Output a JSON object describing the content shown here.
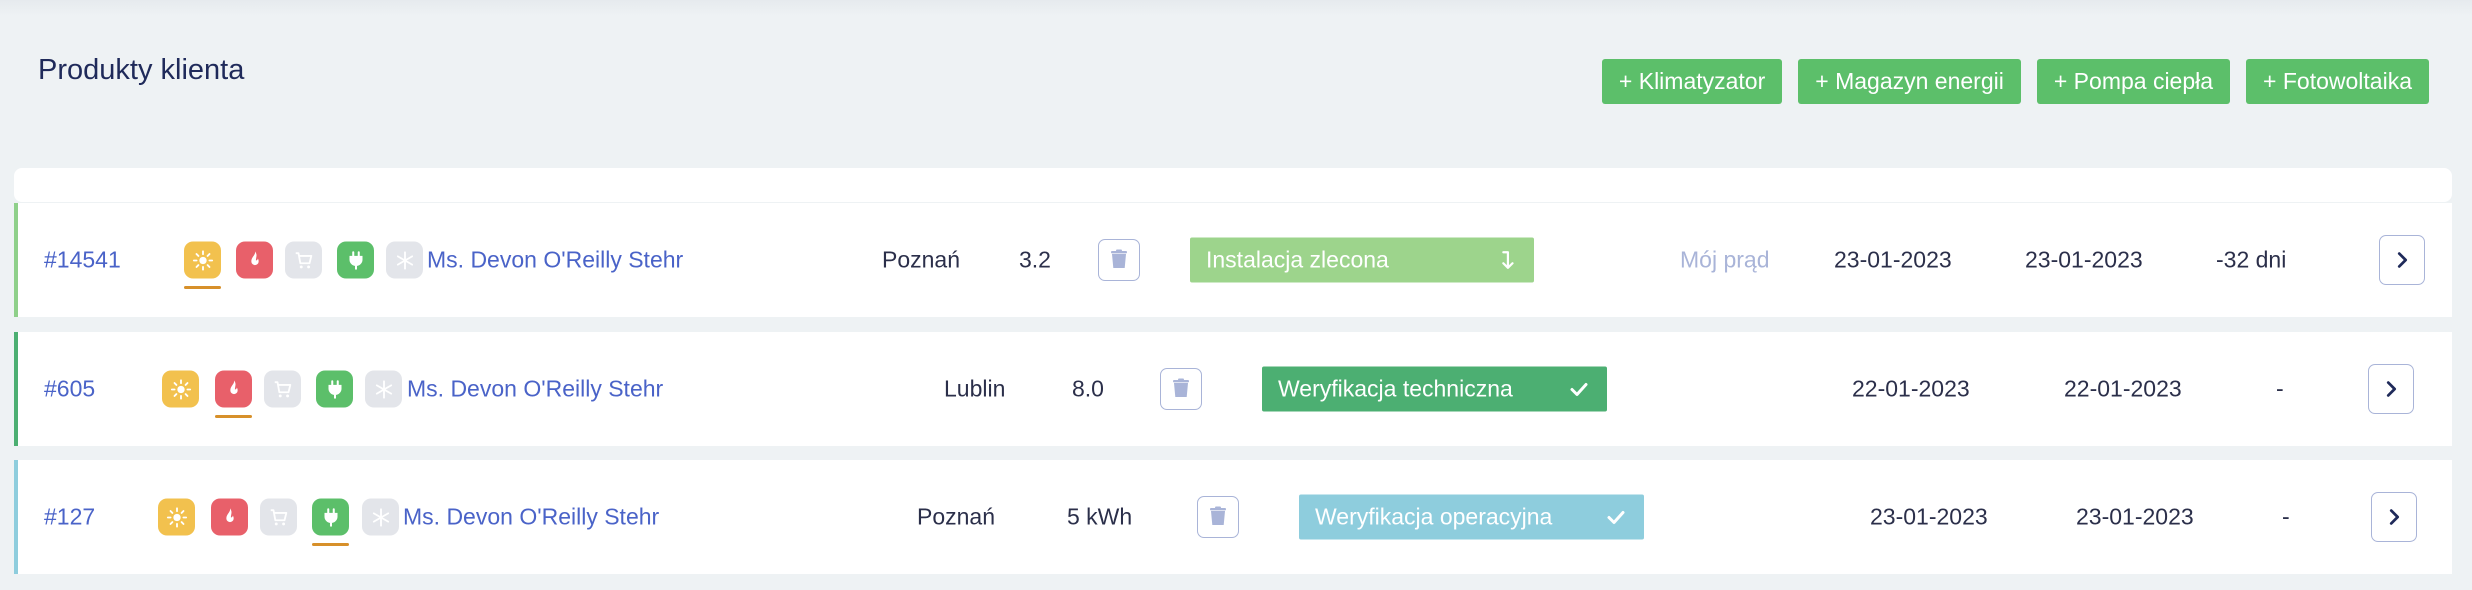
{
  "page": {
    "title": "Produkty klienta"
  },
  "actions": [
    {
      "label": "+ Klimatyzator"
    },
    {
      "label": "+ Magazyn energii"
    },
    {
      "label": "+ Pompa ciepła"
    },
    {
      "label": "+ Fotowoltaika"
    }
  ],
  "colors": {
    "accent_green": "#5cbf6a",
    "sun_active": "#f2c14e",
    "flame_active": "#e8606a",
    "plug_active": "#5cbf6a",
    "inactive_icon": "#e3e5ea",
    "link": "#4a63c8"
  },
  "rows": [
    {
      "id": "#14541",
      "client": "Ms. Devon O'Reilly Stehr",
      "city": "Poznań",
      "value": "3.2",
      "status": "Instalacja zlecona",
      "status_icon": "arrow-down-icon",
      "status_color": "#9dd48c",
      "accent": "#8fd08a",
      "program": "Mój prąd",
      "date1": "23-01-2023",
      "date2": "23-01-2023",
      "days": "-32 dni",
      "active_icon": "sun"
    },
    {
      "id": "#605",
      "client": "Ms. Devon O'Reilly Stehr",
      "city": "Lublin",
      "value": "8.0",
      "status": "Weryfikacja techniczna",
      "status_icon": "check-icon",
      "status_color": "#4caf72",
      "accent": "#4caf72",
      "program": "",
      "date1": "22-01-2023",
      "date2": "22-01-2023",
      "days": "-",
      "active_icon": "flame"
    },
    {
      "id": "#127",
      "client": "Ms. Devon O'Reilly Stehr",
      "city": "Poznań",
      "value": "5 kWh",
      "status": "Weryfikacja operacyjna",
      "status_icon": "check-icon",
      "status_color": "#8ecddd",
      "accent": "#8ecddd",
      "program": "",
      "date1": "23-01-2023",
      "date2": "23-01-2023",
      "days": "-",
      "active_icon": "plug"
    }
  ]
}
